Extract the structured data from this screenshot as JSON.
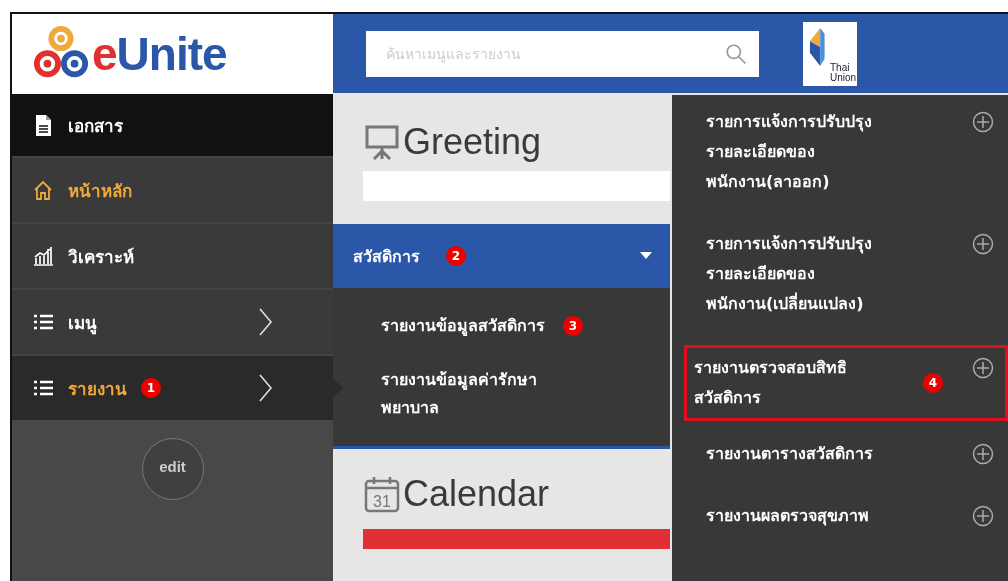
{
  "logo": {
    "text": "eUnite"
  },
  "sidebar": {
    "items": [
      {
        "label": "เอกสาร",
        "kind": "document",
        "highlighted": true,
        "current": false,
        "selected": false,
        "has_submenu": false
      },
      {
        "label": "หน้าหลัก",
        "kind": "home",
        "highlighted": false,
        "current": true,
        "selected": false,
        "has_submenu": false
      },
      {
        "label": "วิเคราะห์",
        "kind": "chart",
        "highlighted": false,
        "current": false,
        "selected": false,
        "has_submenu": false
      },
      {
        "label": "เมนู",
        "kind": "list",
        "highlighted": false,
        "current": false,
        "selected": false,
        "has_submenu": true
      },
      {
        "label": "รายงาน",
        "kind": "list",
        "highlighted": false,
        "current": true,
        "selected": true,
        "has_submenu": true,
        "badge": "1"
      }
    ],
    "edit_button": "edit"
  },
  "top_bar": {
    "search": {
      "placeholder": "ค้นหาเมนูและรายงาน"
    },
    "partner_logo": {
      "text": "Thai Union"
    }
  },
  "greeting": {
    "title": "Greeting"
  },
  "welfare_menu": {
    "label": "สวัสดิการ",
    "badge": "2",
    "expanded": true,
    "items": [
      {
        "label": "รายงานข้อมูลสวัสดิการ",
        "badge": "3"
      },
      {
        "label": "รายงานข้อมูลค่ารักษา\nพยาบาล"
      }
    ]
  },
  "calendar": {
    "title": "Calendar",
    "icon_day": "31"
  },
  "flyout": {
    "items": [
      {
        "label": "รายการแจ้งการปรับปรุง\nรายละเอียดของ\nพนักงาน(ลาออก)",
        "highlighted": false
      },
      {
        "label": "รายการแจ้งการปรับปรุง\nรายละเอียดของ\nพนักงาน(เปลี่ยนแปลง)",
        "highlighted": false
      },
      {
        "label": "รายงานตรวจสอบสิทธิ\nสวัสดิการ",
        "highlighted": true,
        "badge": "4"
      },
      {
        "label": "รายงานตารางสวัสดิการ",
        "highlighted": false
      },
      {
        "label": "รายงานผลตรวจสุขภาพ",
        "highlighted": false
      }
    ]
  }
}
